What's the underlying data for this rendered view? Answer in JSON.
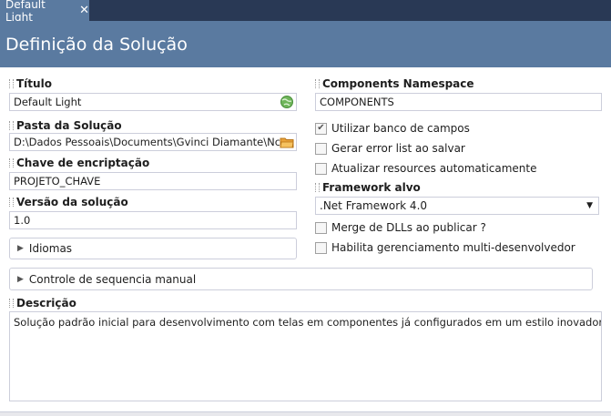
{
  "tab": {
    "title": "Default Light",
    "close_glyph": "✕"
  },
  "header": {
    "title": "Definição da Solução"
  },
  "left": {
    "titulo": {
      "label": "Título",
      "value": "Default Light",
      "icon": "globe-icon"
    },
    "pasta": {
      "label": "Pasta da Solução",
      "value": "D:\\Dados Pessoais\\Documents\\Gvinci Diamante\\Nc",
      "icon": "folder-icon"
    },
    "chave": {
      "label": "Chave de encriptação",
      "value": "PROJETO_CHAVE"
    },
    "versao": {
      "label": "Versão da solução",
      "value": "1.0"
    },
    "idiomas": {
      "label": "Idiomas"
    }
  },
  "right": {
    "namespace": {
      "label": "Components Namespace",
      "value": "COMPONENTS"
    },
    "checks1": [
      {
        "label": "Utilizar banco de campos",
        "checked": true
      },
      {
        "label": "Gerar error list ao salvar",
        "checked": false
      },
      {
        "label": "Atualizar resources automaticamente",
        "checked": false
      }
    ],
    "framework": {
      "label": "Framework alvo",
      "selected": ".Net Framework 4.0"
    },
    "checks2": [
      {
        "label": "Merge de DLLs ao publicar ?",
        "checked": false
      },
      {
        "label": "Habilita gerenciamento multi-desenvolvedor",
        "checked": false
      }
    ]
  },
  "controle": {
    "label": "Controle de sequencia manual"
  },
  "descricao": {
    "label": "Descrição",
    "value": "Solução padrão inicial para desenvolvimento com telas em componentes já configurados em um estilo inovador."
  },
  "colors": {
    "accent": "#5a7aa0",
    "topbar": "#293955",
    "border": "#cccedb"
  }
}
